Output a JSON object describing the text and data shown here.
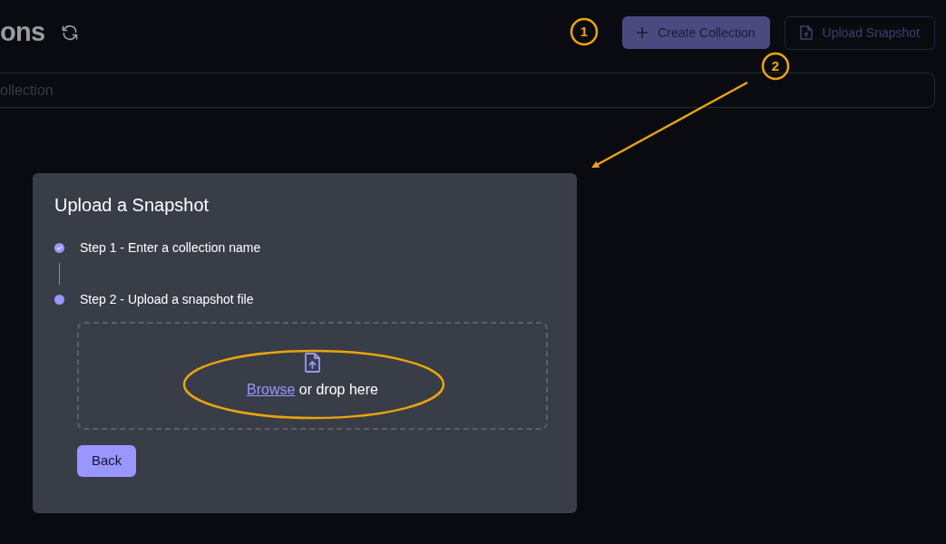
{
  "header": {
    "title": "ons",
    "buttons": [
      {
        "label": "Create Collection",
        "kind": "primary"
      },
      {
        "label": "Upload Snapshot",
        "kind": "outline"
      }
    ]
  },
  "search": {
    "placeholder": "ollection"
  },
  "dialog": {
    "title": "Upload a Snapshot",
    "steps": [
      {
        "label": "Step 1 - Enter a collection name",
        "completed": true
      },
      {
        "label": "Step 2 - Upload a snapshot file",
        "completed": false
      }
    ],
    "dropzone": {
      "link": "Browse",
      "text": "or drop here"
    },
    "back_button": "Back"
  },
  "annotations": [
    {
      "label": "1"
    },
    {
      "label": "2"
    }
  ]
}
